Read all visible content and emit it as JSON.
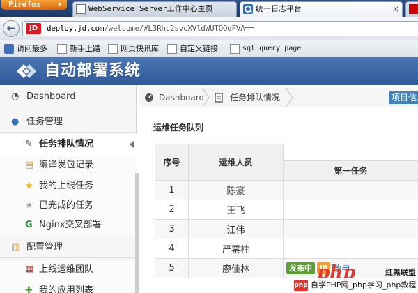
{
  "browser": {
    "app_button": "Firefox",
    "tabs": [
      {
        "title": "WebService Server工作中心主页"
      },
      {
        "title": "统一日志平台"
      },
      {
        "title": ""
      }
    ],
    "url_host": "deploy.jd.com",
    "url_path": "/welcome/#L3Rhc2svcXVldWUTOOdFVA==",
    "site_badge": "JD",
    "bookmarks": [
      "访问最多",
      "新手上路",
      "网页快讯库",
      "自定义链接",
      "sql query page"
    ]
  },
  "app": {
    "title": "自动部署系统"
  },
  "sidebar": {
    "items": [
      {
        "label": "Dashboard",
        "icon": "tachometer-icon"
      },
      {
        "label": "任务管理",
        "icon": "globe-icon"
      },
      {
        "label": "任务排队情况",
        "icon": "edit-icon",
        "active": true
      },
      {
        "label": "编译发包记录",
        "icon": "folder-icon"
      },
      {
        "label": "我的上线任务",
        "icon": "star-icon"
      },
      {
        "label": "已完成的任务",
        "icon": "star-icon"
      },
      {
        "label": "Nginx交叉部署",
        "icon": "g-icon"
      },
      {
        "label": "配置管理",
        "icon": "folder-open-icon"
      },
      {
        "label": "上线运维团队",
        "icon": "gift-icon"
      },
      {
        "label": "我的应用列表",
        "icon": "puzzle-icon"
      }
    ]
  },
  "main": {
    "breadcrumb": [
      "Dashboard",
      "任务排队情况"
    ],
    "project_button": "项目信息",
    "section_title": "运维任务队列",
    "table": {
      "headers": {
        "index": "序号",
        "operator": "运维人员",
        "first_task": "第一任务"
      },
      "rows": [
        {
          "index": "1",
          "operator": "陈豪"
        },
        {
          "index": "2",
          "operator": "王飞"
        },
        {
          "index": "3",
          "operator": "江伟"
        },
        {
          "index": "4",
          "operator": "严票柱"
        },
        {
          "index": "5",
          "operator": "廖佳林",
          "badge_green": "发布中",
          "badge_orange": "lll",
          "link": "改申"
        }
      ]
    }
  },
  "watermark": {
    "logo": "php",
    "logo_sub": "红黑联盟",
    "footer_icon": "php",
    "footer": "自学PHP网_php学习_php教程"
  },
  "colors": {
    "header_bg": "#3b67a8",
    "badge_green": "#5b9e34",
    "badge_orange": "#f0a02a",
    "project_btn": "#3f83b9"
  }
}
